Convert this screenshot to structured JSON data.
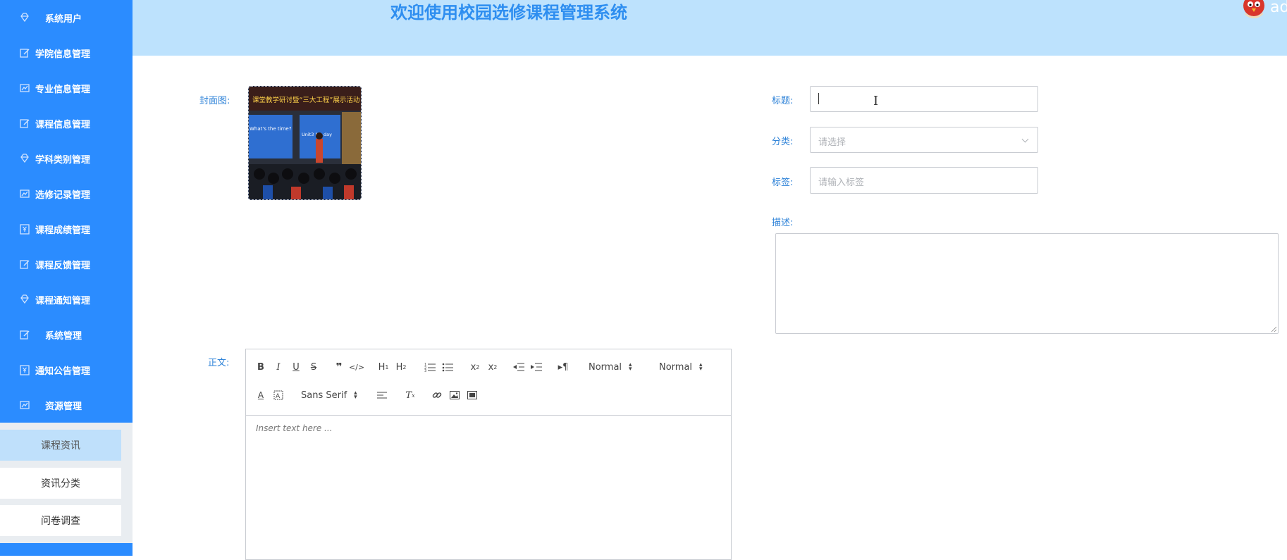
{
  "sidebar": {
    "menu": [
      {
        "label": "系统用户",
        "icon": "diamond-icon"
      },
      {
        "label": "学院信息管理",
        "icon": "edit-icon"
      },
      {
        "label": "专业信息管理",
        "icon": "chart-icon"
      },
      {
        "label": "课程信息管理",
        "icon": "edit-icon"
      },
      {
        "label": "学科类别管理",
        "icon": "diamond-icon"
      },
      {
        "label": "选修记录管理",
        "icon": "chart-icon"
      },
      {
        "label": "课程成绩管理",
        "icon": "yen-icon"
      },
      {
        "label": "课程反馈管理",
        "icon": "edit-icon"
      },
      {
        "label": "课程通知管理",
        "icon": "diamond-icon"
      },
      {
        "label": "系统管理",
        "icon": "edit-icon"
      },
      {
        "label": "通知公告管理",
        "icon": "yen-icon"
      },
      {
        "label": "资源管理",
        "icon": "chart-icon"
      }
    ],
    "submenu": [
      {
        "label": "课程资讯"
      },
      {
        "label": "资讯分类"
      },
      {
        "label": "问卷调查"
      }
    ]
  },
  "header": {
    "title": "欢迎使用校园选修课程管理系统",
    "username": "admin"
  },
  "form": {
    "cover_label": "封面图:",
    "cover_banner": "课堂教学研讨暨“三大工程”展示活动",
    "cover_screen_left": "What's the time?",
    "cover_screen_right": "Unit3 My day",
    "title_label": "标题:",
    "category_label": "分类:",
    "category_placeholder": "请选择",
    "tag_label": "标签:",
    "tag_placeholder": "请输入标签",
    "desc_label": "描述:",
    "body_label": "正文:"
  },
  "editor": {
    "header_select": "Normal",
    "size_select": "Normal",
    "font_select": "Sans Serif",
    "placeholder": "Insert text here ..."
  },
  "colors": {
    "primary": "#2b8cff",
    "header_bg": "#bde2fd",
    "label": "#2f83d8",
    "active_sub": "#bfe0fb"
  }
}
